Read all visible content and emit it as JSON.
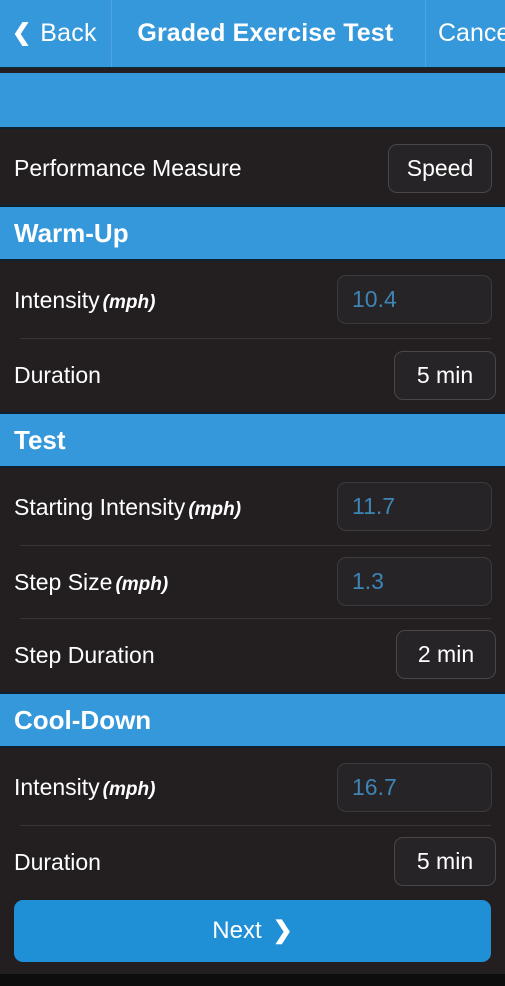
{
  "navbar": {
    "back_label": "Back",
    "back_icon": "chevron-left-icon",
    "title": "Graded Exercise Test",
    "cancel_label": "Cancel"
  },
  "performance_measure": {
    "label": "Performance Measure",
    "value": "Speed"
  },
  "sections": [
    {
      "title": "Warm-Up",
      "rows": [
        {
          "label": "Intensity",
          "unit": "(mph)",
          "value": "10.4",
          "kind": "input"
        },
        {
          "label": "Duration",
          "unit": "",
          "value": "5 min",
          "kind": "pill"
        }
      ]
    },
    {
      "title": "Test",
      "rows": [
        {
          "label": "Starting Intensity",
          "unit": "(mph)",
          "value": "11.7",
          "kind": "input"
        },
        {
          "label": "Step Size",
          "unit": "(mph)",
          "value": "1.3",
          "kind": "input"
        },
        {
          "label": "Step Duration",
          "unit": "",
          "value": "2 min",
          "kind": "pill"
        }
      ]
    },
    {
      "title": "Cool-Down",
      "rows": [
        {
          "label": "Intensity",
          "unit": "(mph)",
          "value": "16.7",
          "kind": "input"
        },
        {
          "label": "Duration",
          "unit": "",
          "value": "5 min",
          "kind": "pill"
        }
      ]
    }
  ],
  "next_button": {
    "label": "Next",
    "icon": "chevron-right-icon"
  },
  "colors": {
    "accent_blue": "#3498db",
    "background_dark": "#231f20",
    "input_text_blue": "#3d85b5",
    "button_blue": "#1f8fd6"
  }
}
